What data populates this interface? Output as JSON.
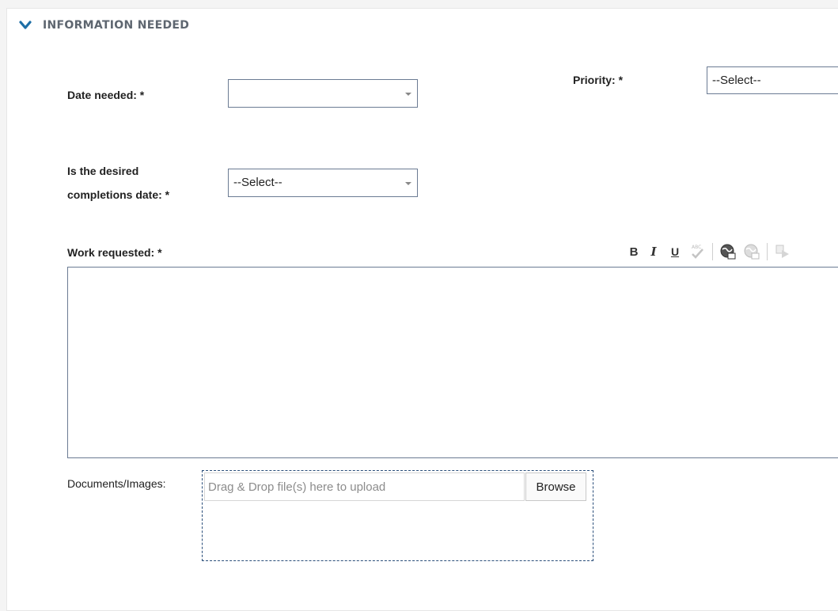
{
  "section": {
    "title": "INFORMATION NEEDED",
    "toggle_icon": "chevron-down-icon",
    "accent_color": "#1e6fa6"
  },
  "fields": {
    "date_needed": {
      "label": "Date needed: *",
      "value": ""
    },
    "priority": {
      "label": "Priority: *",
      "value": "--Select--"
    },
    "completion": {
      "label_line1": "Is the desired",
      "label_line2": "completions date: *",
      "value": "--Select--"
    },
    "work_requested": {
      "label": "Work requested: *",
      "value": ""
    }
  },
  "toolbar": {
    "bold": "B",
    "italic": "I",
    "underline": "U",
    "icons": [
      "spellcheck-icon",
      "web-link-icon",
      "web-unlink-icon",
      "insert-icon"
    ]
  },
  "upload": {
    "label": "Documents/Images:",
    "placeholder": "Drag & Drop file(s) here to upload",
    "browse_label": "Browse"
  }
}
